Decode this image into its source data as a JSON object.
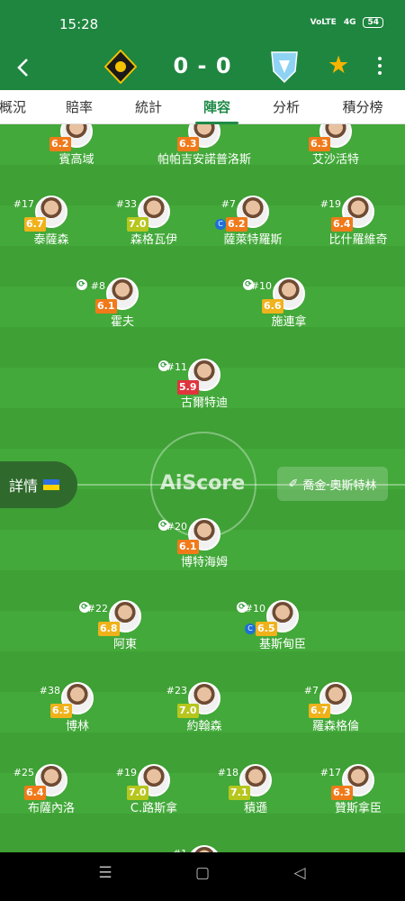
{
  "status_bar": {
    "time": "15:28",
    "network": "4G",
    "volte": "VoLTE",
    "battery": "54"
  },
  "header": {
    "back_icon": "chevron-left-icon",
    "home_logo": "aik-crest",
    "away_logo": "malmo-crest",
    "score": "0 - 0",
    "favorite_icon": "star-icon",
    "more_icon": "more-vert-icon",
    "colors": {
      "bar": "#1f8640",
      "star": "#f5b400"
    }
  },
  "tabs": [
    {
      "label": "概況",
      "active": false
    },
    {
      "label": "賠率",
      "active": false
    },
    {
      "label": "統計",
      "active": false
    },
    {
      "label": "陣容",
      "active": true
    },
    {
      "label": "分析",
      "active": false
    },
    {
      "label": "積分榜",
      "active": false
    }
  ],
  "pitch": {
    "watermark": "AiScore",
    "details_label": "詳情",
    "coach_name": "喬金·奧斯特林",
    "coach_icon": "whistle-icon"
  },
  "players": [
    {
      "name": "賓高域",
      "number": "",
      "rating": "6.2"
    },
    {
      "name": "帕帕吉安諾普洛斯",
      "number": "",
      "rating": "6.3"
    },
    {
      "name": "艾沙活特",
      "number": "",
      "rating": "6.3"
    },
    {
      "name": "泰薩森",
      "number": "#17",
      "rating": "6.7"
    },
    {
      "name": "森格瓦伊",
      "number": "#33",
      "rating": "7.0"
    },
    {
      "name": "薩萊特羅斯",
      "number": "#7",
      "rating": "6.2"
    },
    {
      "name": "比什羅維奇",
      "number": "#19",
      "rating": "6.4"
    },
    {
      "name": "霍夫",
      "number": "#8",
      "rating": "6.1"
    },
    {
      "name": "施連拿",
      "number": "#10",
      "rating": "6.6"
    },
    {
      "name": "古爾特迪",
      "number": "#11",
      "rating": "5.9"
    },
    {
      "name": "博特海姆",
      "number": "#20",
      "rating": "6.1"
    },
    {
      "name": "阿東",
      "number": "#22",
      "rating": "6.8"
    },
    {
      "name": "基斯甸臣",
      "number": "#10",
      "rating": "6.5"
    },
    {
      "name": "博林",
      "number": "#38",
      "rating": "6.5"
    },
    {
      "name": "約翰森",
      "number": "#23",
      "rating": "7.0"
    },
    {
      "name": "羅森格倫",
      "number": "#7",
      "rating": "6.7"
    },
    {
      "name": "布薩內洛",
      "number": "#25",
      "rating": "6.4"
    },
    {
      "name": "C.路斯拿",
      "number": "#19",
      "rating": "7.0"
    },
    {
      "name": "積遜",
      "number": "#18",
      "rating": "7.1"
    },
    {
      "name": "贊斯拿臣",
      "number": "#17",
      "rating": "6.3"
    },
    {
      "name": "",
      "number": "#1",
      "rating": ""
    }
  ],
  "player_flags": {
    "substituted": [
      7,
      8,
      9,
      10,
      11,
      12
    ],
    "captain": [
      5,
      12
    ]
  },
  "rating_colors": {
    "low": "#e0343d",
    "mid": "#f07a1a",
    "good": "#f0b21a",
    "high": "#b6c61d"
  },
  "nav_bar": {
    "menu_icon": "menu-icon",
    "home_icon": "square-icon",
    "back_icon": "triangle-back-icon"
  }
}
